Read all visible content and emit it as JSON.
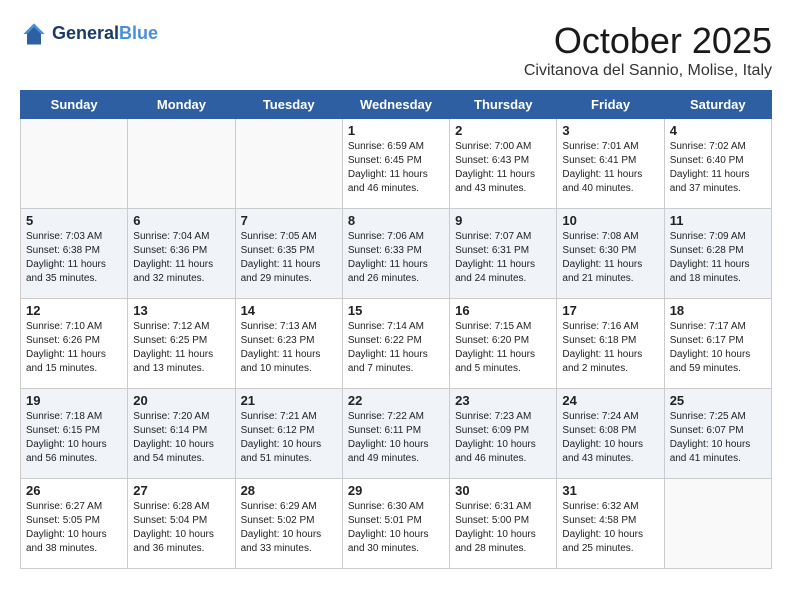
{
  "header": {
    "logo_line1": "General",
    "logo_line2": "Blue",
    "title": "October 2025",
    "subtitle": "Civitanova del Sannio, Molise, Italy"
  },
  "days_of_week": [
    "Sunday",
    "Monday",
    "Tuesday",
    "Wednesday",
    "Thursday",
    "Friday",
    "Saturday"
  ],
  "weeks": [
    [
      {
        "date": "",
        "content": ""
      },
      {
        "date": "",
        "content": ""
      },
      {
        "date": "",
        "content": ""
      },
      {
        "date": "1",
        "content": "Sunrise: 6:59 AM\nSunset: 6:45 PM\nDaylight: 11 hours\nand 46 minutes."
      },
      {
        "date": "2",
        "content": "Sunrise: 7:00 AM\nSunset: 6:43 PM\nDaylight: 11 hours\nand 43 minutes."
      },
      {
        "date": "3",
        "content": "Sunrise: 7:01 AM\nSunset: 6:41 PM\nDaylight: 11 hours\nand 40 minutes."
      },
      {
        "date": "4",
        "content": "Sunrise: 7:02 AM\nSunset: 6:40 PM\nDaylight: 11 hours\nand 37 minutes."
      }
    ],
    [
      {
        "date": "5",
        "content": "Sunrise: 7:03 AM\nSunset: 6:38 PM\nDaylight: 11 hours\nand 35 minutes."
      },
      {
        "date": "6",
        "content": "Sunrise: 7:04 AM\nSunset: 6:36 PM\nDaylight: 11 hours\nand 32 minutes."
      },
      {
        "date": "7",
        "content": "Sunrise: 7:05 AM\nSunset: 6:35 PM\nDaylight: 11 hours\nand 29 minutes."
      },
      {
        "date": "8",
        "content": "Sunrise: 7:06 AM\nSunset: 6:33 PM\nDaylight: 11 hours\nand 26 minutes."
      },
      {
        "date": "9",
        "content": "Sunrise: 7:07 AM\nSunset: 6:31 PM\nDaylight: 11 hours\nand 24 minutes."
      },
      {
        "date": "10",
        "content": "Sunrise: 7:08 AM\nSunset: 6:30 PM\nDaylight: 11 hours\nand 21 minutes."
      },
      {
        "date": "11",
        "content": "Sunrise: 7:09 AM\nSunset: 6:28 PM\nDaylight: 11 hours\nand 18 minutes."
      }
    ],
    [
      {
        "date": "12",
        "content": "Sunrise: 7:10 AM\nSunset: 6:26 PM\nDaylight: 11 hours\nand 15 minutes."
      },
      {
        "date": "13",
        "content": "Sunrise: 7:12 AM\nSunset: 6:25 PM\nDaylight: 11 hours\nand 13 minutes."
      },
      {
        "date": "14",
        "content": "Sunrise: 7:13 AM\nSunset: 6:23 PM\nDaylight: 11 hours\nand 10 minutes."
      },
      {
        "date": "15",
        "content": "Sunrise: 7:14 AM\nSunset: 6:22 PM\nDaylight: 11 hours\nand 7 minutes."
      },
      {
        "date": "16",
        "content": "Sunrise: 7:15 AM\nSunset: 6:20 PM\nDaylight: 11 hours\nand 5 minutes."
      },
      {
        "date": "17",
        "content": "Sunrise: 7:16 AM\nSunset: 6:18 PM\nDaylight: 11 hours\nand 2 minutes."
      },
      {
        "date": "18",
        "content": "Sunrise: 7:17 AM\nSunset: 6:17 PM\nDaylight: 10 hours\nand 59 minutes."
      }
    ],
    [
      {
        "date": "19",
        "content": "Sunrise: 7:18 AM\nSunset: 6:15 PM\nDaylight: 10 hours\nand 56 minutes."
      },
      {
        "date": "20",
        "content": "Sunrise: 7:20 AM\nSunset: 6:14 PM\nDaylight: 10 hours\nand 54 minutes."
      },
      {
        "date": "21",
        "content": "Sunrise: 7:21 AM\nSunset: 6:12 PM\nDaylight: 10 hours\nand 51 minutes."
      },
      {
        "date": "22",
        "content": "Sunrise: 7:22 AM\nSunset: 6:11 PM\nDaylight: 10 hours\nand 49 minutes."
      },
      {
        "date": "23",
        "content": "Sunrise: 7:23 AM\nSunset: 6:09 PM\nDaylight: 10 hours\nand 46 minutes."
      },
      {
        "date": "24",
        "content": "Sunrise: 7:24 AM\nSunset: 6:08 PM\nDaylight: 10 hours\nand 43 minutes."
      },
      {
        "date": "25",
        "content": "Sunrise: 7:25 AM\nSunset: 6:07 PM\nDaylight: 10 hours\nand 41 minutes."
      }
    ],
    [
      {
        "date": "26",
        "content": "Sunrise: 6:27 AM\nSunset: 5:05 PM\nDaylight: 10 hours\nand 38 minutes."
      },
      {
        "date": "27",
        "content": "Sunrise: 6:28 AM\nSunset: 5:04 PM\nDaylight: 10 hours\nand 36 minutes."
      },
      {
        "date": "28",
        "content": "Sunrise: 6:29 AM\nSunset: 5:02 PM\nDaylight: 10 hours\nand 33 minutes."
      },
      {
        "date": "29",
        "content": "Sunrise: 6:30 AM\nSunset: 5:01 PM\nDaylight: 10 hours\nand 30 minutes."
      },
      {
        "date": "30",
        "content": "Sunrise: 6:31 AM\nSunset: 5:00 PM\nDaylight: 10 hours\nand 28 minutes."
      },
      {
        "date": "31",
        "content": "Sunrise: 6:32 AM\nSunset: 4:58 PM\nDaylight: 10 hours\nand 25 minutes."
      },
      {
        "date": "",
        "content": ""
      }
    ]
  ]
}
